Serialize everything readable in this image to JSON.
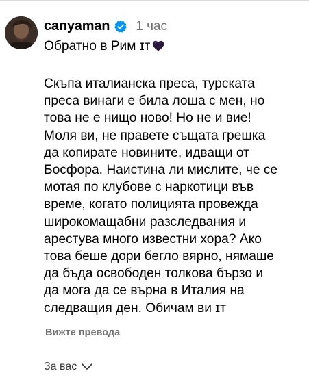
{
  "post": {
    "username": "canyaman",
    "verified": true,
    "time": "1 час",
    "caption_line": "Обратно в Рим ɪт",
    "caption_emoji": "black-heart",
    "body_lines": [
      "Скъпа италианска преса, турската",
      "преса винаги е била лоша с мен, но",
      "това не е нищо ново! Но не и вие!",
      "Моля ви, не правете същата грешка",
      "да копирате новините, идващи от",
      "Босфора. Наистина ли мислите, че се",
      "мотая по клубове с наркотици във",
      "време, когато полицията провежда",
      "широкомащабни разследвания и",
      "арестува много известни хора? Ако",
      "това беше дори бегло вярно, нямаше",
      "да бъда освободен толкова бързо и",
      "да мога да се върна в Италия на",
      "следващия ден. Обичам ви ɪт"
    ],
    "see_translation": "Вижте превода"
  },
  "footer": {
    "for_you_label": "За вас"
  },
  "colors": {
    "verified_blue": "#0095f6",
    "meta_gray": "#737373",
    "heart": "#2b1a3d"
  },
  "icons": {
    "verified": "verified-badge-icon",
    "heart": "black-heart-icon",
    "chevron": "chevron-down-icon"
  }
}
